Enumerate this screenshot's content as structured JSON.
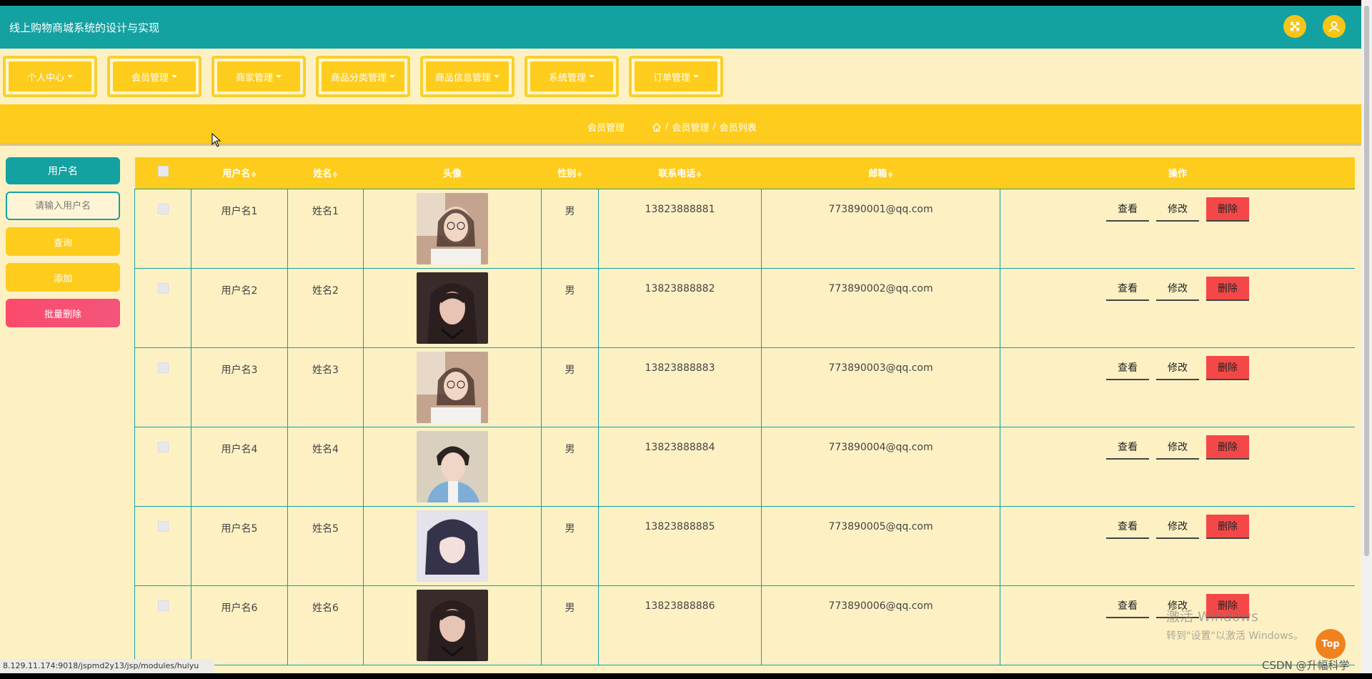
{
  "app": {
    "title": "线上购物商城系统的设计与实现"
  },
  "nav": [
    {
      "label": "个人中心"
    },
    {
      "label": "会员管理"
    },
    {
      "label": "商家管理"
    },
    {
      "label": "商品分类管理"
    },
    {
      "label": "商品信息管理"
    },
    {
      "label": "系统管理"
    },
    {
      "label": "订单管理"
    }
  ],
  "breadcrumb": {
    "title": "会员管理",
    "path1": "会员管理",
    "sep": "/",
    "path2": "会员列表"
  },
  "search": {
    "label": "用户名",
    "placeholder": "请输入用户名",
    "query_label": "查询",
    "add_label": "添加",
    "batch_delete_label": "批量删除"
  },
  "table": {
    "headers": {
      "username": "用户名",
      "name": "姓名",
      "avatar": "头像",
      "gender": "性别",
      "phone": "联系电话",
      "email": "邮箱",
      "ops": "操作",
      "sort_glyph": "≑"
    },
    "ops": {
      "view": "查看",
      "edit": "修改",
      "delete": "删除"
    },
    "rows": [
      {
        "username": "用户名1",
        "name": "姓名1",
        "gender": "男",
        "phone": "13823888881",
        "email": "773890001@qq.com",
        "avatar": "girl-glasses"
      },
      {
        "username": "用户名2",
        "name": "姓名2",
        "gender": "男",
        "phone": "13823888882",
        "email": "773890002@qq.com",
        "avatar": "girl-dark"
      },
      {
        "username": "用户名3",
        "name": "姓名3",
        "gender": "男",
        "phone": "13823888883",
        "email": "773890003@qq.com",
        "avatar": "girl-glasses"
      },
      {
        "username": "用户名4",
        "name": "姓名4",
        "gender": "男",
        "phone": "13823888884",
        "email": "773890004@qq.com",
        "avatar": "boy"
      },
      {
        "username": "用户名5",
        "name": "姓名5",
        "gender": "男",
        "phone": "13823888885",
        "email": "773890005@qq.com",
        "avatar": "girl-short-hair"
      },
      {
        "username": "用户名6",
        "name": "姓名6",
        "gender": "男",
        "phone": "13823888886",
        "email": "773890006@qq.com",
        "avatar": "girl-dark"
      }
    ]
  },
  "status_url": "8.129.11.174:9018/jspmd2y13/jsp/modules/huiyu",
  "top_label": "Top",
  "watermark": {
    "line1": "激活 Windows",
    "line2": "转到\"设置\"以激活 Windows。"
  },
  "csdn": "CSDN @升幅科学",
  "colors": {
    "teal": "#14a1a2",
    "yellow": "#fecc1c",
    "bg": "#fdf1c4",
    "delete": "#f44848",
    "pink": "#fb4a6b",
    "top": "#f0821e"
  },
  "icons": {
    "fullscreen": "fullscreen-icon",
    "user": "user-icon",
    "home": "home-icon",
    "cursor": "cursor-icon"
  }
}
